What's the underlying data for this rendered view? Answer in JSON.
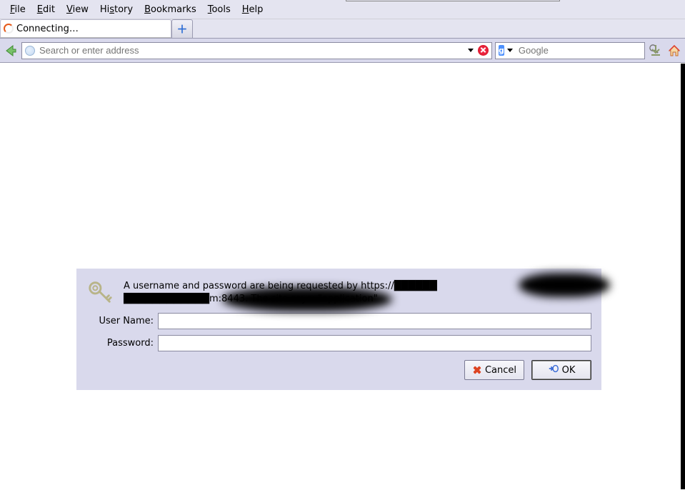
{
  "menubar": {
    "file": "File",
    "edit": "Edit",
    "view": "View",
    "history": "History",
    "bookmarks": "Bookmarks",
    "tools": "Tools",
    "help": "Help"
  },
  "tab": {
    "title": "Connecting…"
  },
  "urlbar": {
    "placeholder": "Search or enter address",
    "value": ""
  },
  "searchbar": {
    "engine_label": "g",
    "placeholder": "Google",
    "value": ""
  },
  "auth_dialog": {
    "message_prefix": "A username and password are being requested by https://",
    "message_mid_a": "██████",
    "message_mid_b": "████████████m:8443. The site says: \"application\"",
    "username_label": "User Name:",
    "password_label": "Password:",
    "username_value": "",
    "password_value": "",
    "cancel_label": "Cancel",
    "ok_label": "OK"
  }
}
